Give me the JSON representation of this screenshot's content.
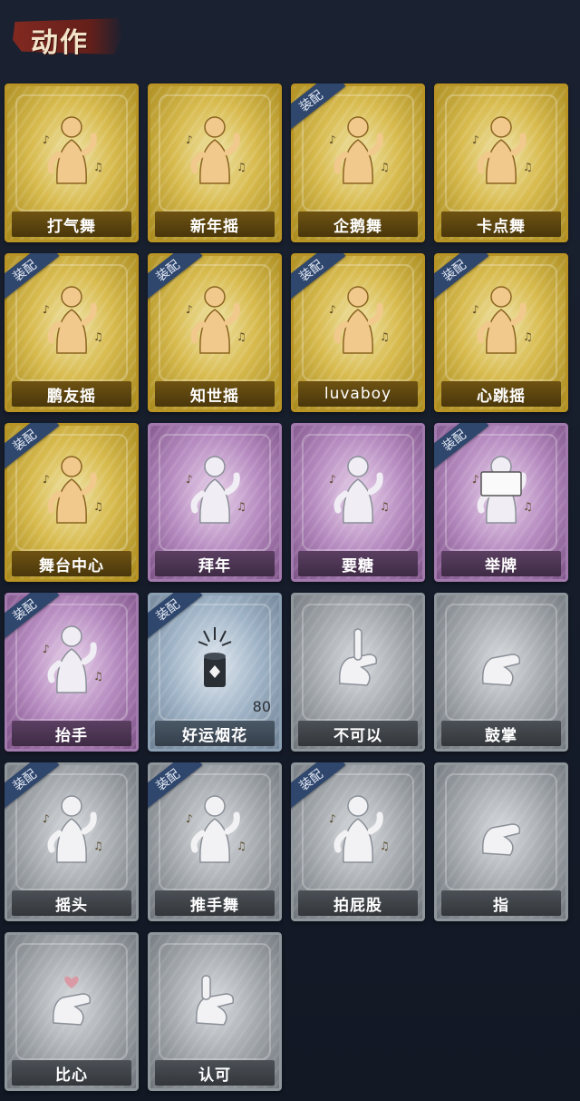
{
  "section": {
    "title": "动作"
  },
  "badge_label": "装配",
  "cards": [
    {
      "name": "打气舞",
      "rarity": "gold",
      "equipped": false,
      "icon": "dance-figure-icon"
    },
    {
      "name": "新年摇",
      "rarity": "gold",
      "equipped": false,
      "icon": "dance-figure-icon"
    },
    {
      "name": "企鹅舞",
      "rarity": "gold",
      "equipped": true,
      "icon": "dance-figure-icon"
    },
    {
      "name": "卡点舞",
      "rarity": "gold",
      "equipped": false,
      "icon": "dance-figure-icon"
    },
    {
      "name": "鹏友摇",
      "rarity": "gold",
      "equipped": true,
      "icon": "dance-figure-icon"
    },
    {
      "name": "知世摇",
      "rarity": "gold",
      "equipped": true,
      "icon": "dance-figure-icon"
    },
    {
      "name": "luvaboy",
      "rarity": "gold",
      "equipped": true,
      "icon": "dance-figure-icon"
    },
    {
      "name": "心跳摇",
      "rarity": "gold",
      "equipped": true,
      "icon": "dance-figure-icon"
    },
    {
      "name": "舞台中心",
      "rarity": "gold",
      "equipped": true,
      "icon": "dance-figure-icon"
    },
    {
      "name": "拜年",
      "rarity": "purple",
      "equipped": false,
      "icon": "bow-figure-icon"
    },
    {
      "name": "要糖",
      "rarity": "purple",
      "equipped": false,
      "icon": "reach-figure-icon"
    },
    {
      "name": "举牌",
      "rarity": "purple",
      "equipped": true,
      "icon": "sign-figure-icon"
    },
    {
      "name": "抬手",
      "rarity": "purple",
      "equipped": true,
      "icon": "raise-hand-figure-icon"
    },
    {
      "name": "好运烟花",
      "rarity": "blue",
      "equipped": true,
      "icon": "firework-icon",
      "count": "80"
    },
    {
      "name": "不可以",
      "rarity": "gray",
      "equipped": false,
      "icon": "finger-wag-icon"
    },
    {
      "name": "鼓掌",
      "rarity": "gray",
      "equipped": false,
      "icon": "clap-icon"
    },
    {
      "name": "摇头",
      "rarity": "gray",
      "equipped": true,
      "icon": "shake-head-figure-icon"
    },
    {
      "name": "推手舞",
      "rarity": "gray",
      "equipped": true,
      "icon": "push-dance-figure-icon"
    },
    {
      "name": "拍屁股",
      "rarity": "gray",
      "equipped": true,
      "icon": "slap-figure-icon"
    },
    {
      "name": "指",
      "rarity": "gray",
      "equipped": false,
      "icon": "point-hand-icon"
    },
    {
      "name": "比心",
      "rarity": "gray",
      "equipped": false,
      "icon": "finger-heart-icon"
    },
    {
      "name": "认可",
      "rarity": "gray",
      "equipped": false,
      "icon": "thumbs-up-icon"
    }
  ]
}
